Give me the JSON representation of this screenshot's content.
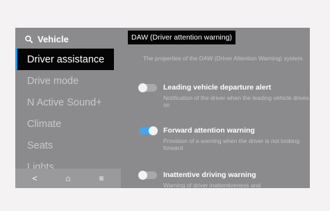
{
  "sidebar": {
    "search": {
      "label": "Vehicle",
      "icon": "search-icon"
    },
    "items": [
      {
        "label": "Driver assistance",
        "active": true
      },
      {
        "label": "Drive mode",
        "active": false
      },
      {
        "label": "N Active Sound+",
        "active": false
      },
      {
        "label": "Climate",
        "active": false
      },
      {
        "label": "Seats",
        "active": false
      },
      {
        "label": "Lights",
        "active": false
      }
    ]
  },
  "bottom_bar": {
    "back": "<",
    "home": "⌂",
    "menu": "≡"
  },
  "tooltip": {
    "text": "DAW (Driver attention warning)"
  },
  "content": {
    "description": "The properties of the DAW (Driver Attention Warning) system",
    "settings": [
      {
        "title": "Leading vehicle departure alert",
        "description": "Notification of the driver when the leading vehicle drives on",
        "enabled": false
      },
      {
        "title": "Forward attention warning",
        "description": "Provision of a warning when the driver is not looking forward",
        "enabled": true
      },
      {
        "title": "Inattentive driving warning",
        "description": "Warning of driver inattentiveness and",
        "enabled": false
      }
    ]
  },
  "colors": {
    "accent": "#1d97f2",
    "toggle_on": "#4aa4e6",
    "panel_bg": "#8b8b8d",
    "active_bg": "#050505"
  }
}
